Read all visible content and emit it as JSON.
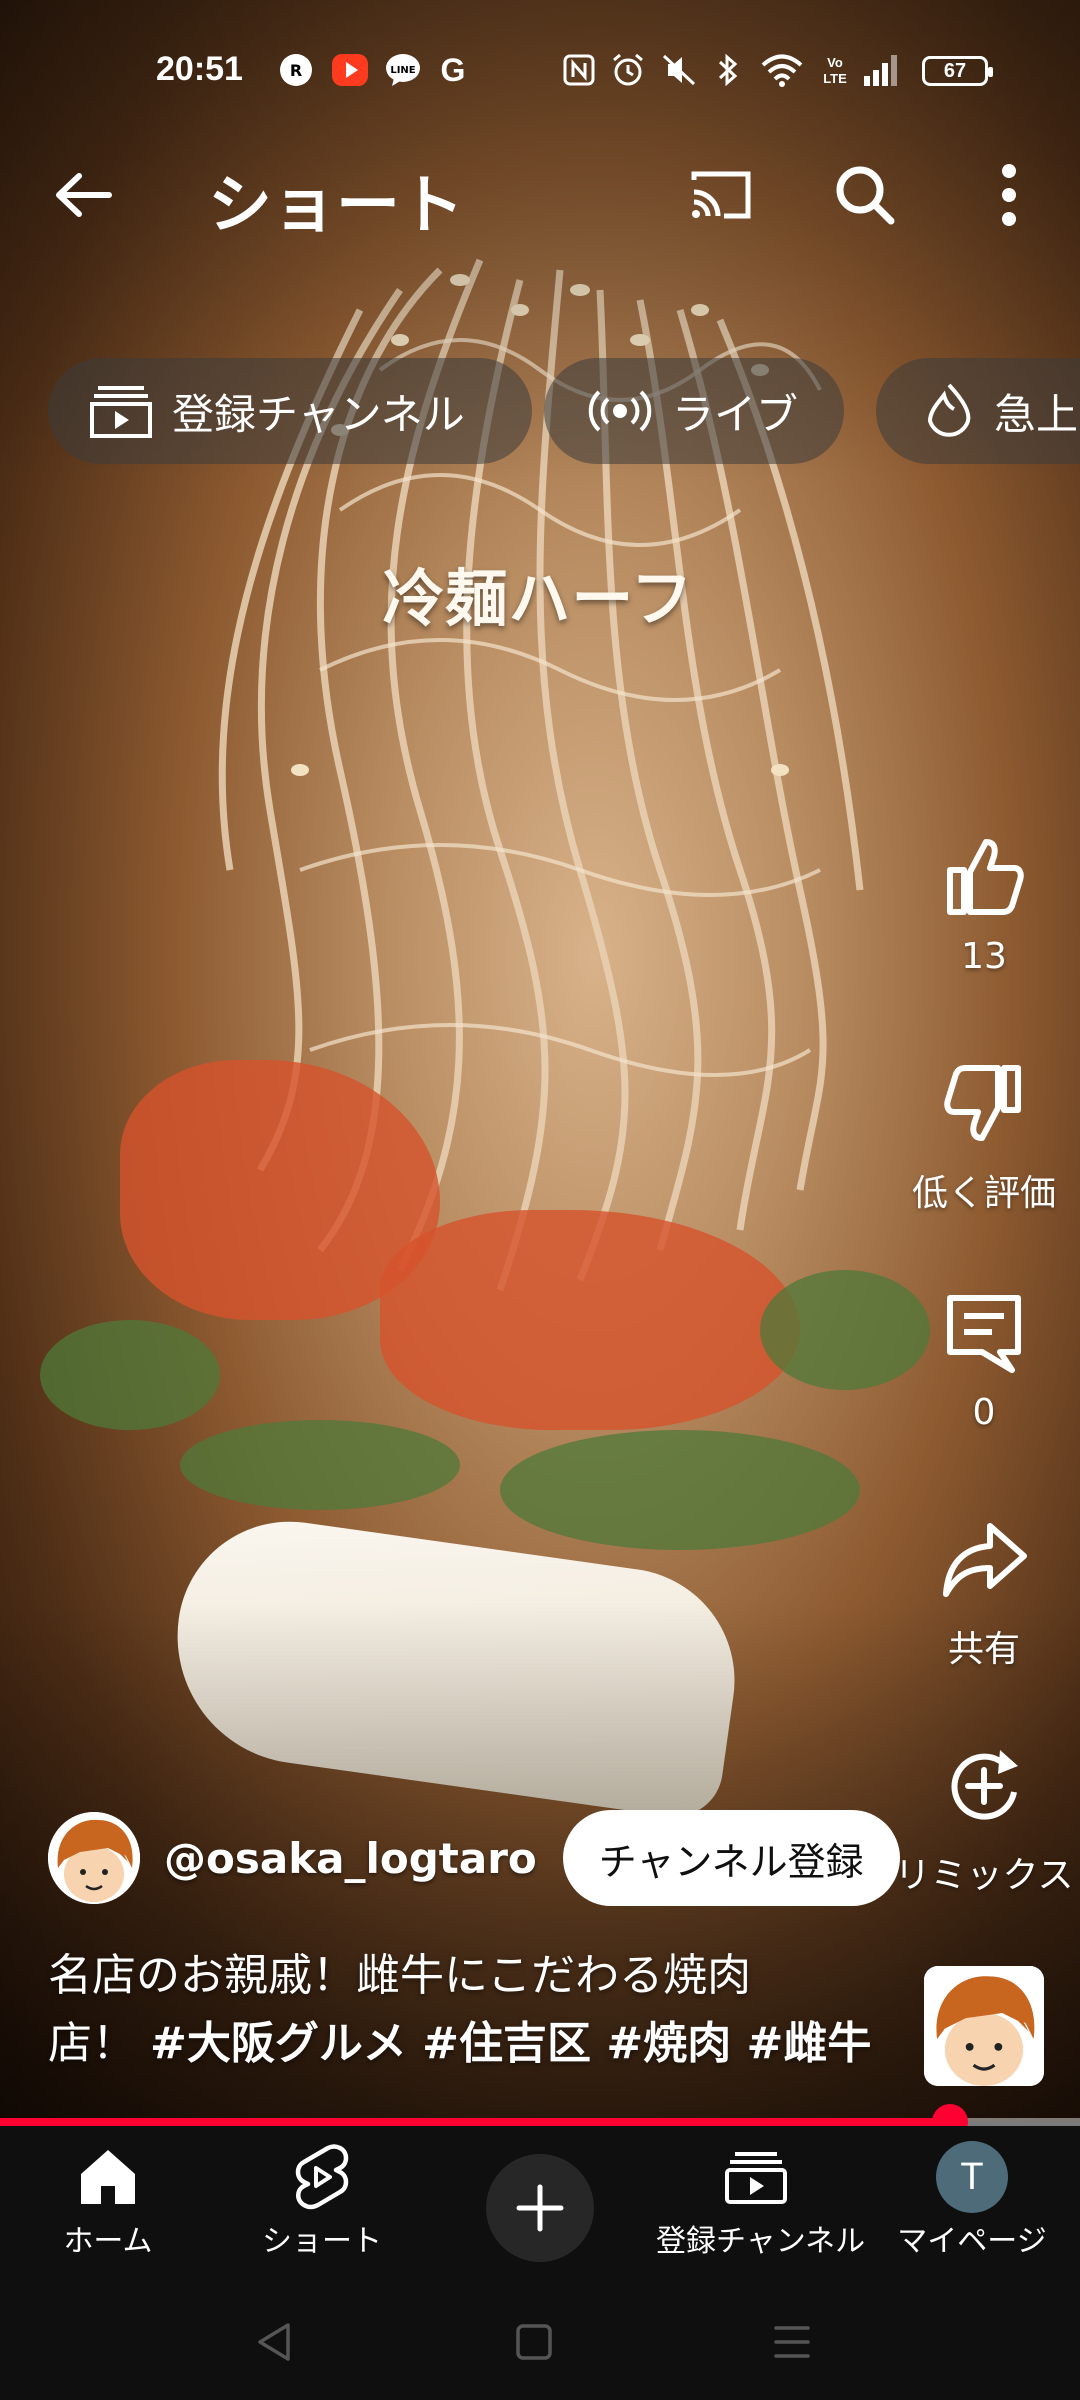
{
  "status_bar": {
    "time": "20:51",
    "battery": "67",
    "left_icons": [
      "r-link-icon",
      "record-icon",
      "line-icon",
      "google-icon"
    ],
    "right_icons": [
      "nfc-icon",
      "alarm-icon",
      "mute-icon",
      "bluetooth-icon",
      "wifi-icon",
      "volte-icon",
      "signal-icon"
    ]
  },
  "top_bar": {
    "title": "ショート",
    "buttons": [
      "back-arrow-icon",
      "cast-icon",
      "search-icon",
      "more-vertical-icon"
    ]
  },
  "chips": [
    {
      "label": "登録チャンネル",
      "icon": "subscriptions-icon"
    },
    {
      "label": "ライブ",
      "icon": "live-icon"
    },
    {
      "label": "急上",
      "icon": "trending-icon"
    }
  ],
  "video": {
    "overlay_text": "冷麺ハーフ"
  },
  "actions": {
    "like_count": "13",
    "dislike_label": "低く評価",
    "comment_count": "0",
    "share_label": "共有",
    "remix_label": "リミックス"
  },
  "channel": {
    "handle": "@osaka_logtaro",
    "subscribe_label": "チャンネル登録"
  },
  "description": {
    "line1": "名店のお親戚！雌牛にこだわる焼肉",
    "line2_prefix": "店！",
    "hashtags": "#大阪グルメ #住吉区 #焼肉 #雌牛"
  },
  "progress": {
    "fraction": 0.88
  },
  "bottom_nav": {
    "home": "ホーム",
    "shorts": "ショート",
    "subscriptions": "登録チャンネル",
    "mypage": "マイページ",
    "avatar_letter": "T"
  },
  "colors": {
    "accent_red": "#ff0033",
    "nav_background": "#0f0f0f",
    "chip_background": "rgba(60,60,60,0.55)"
  }
}
